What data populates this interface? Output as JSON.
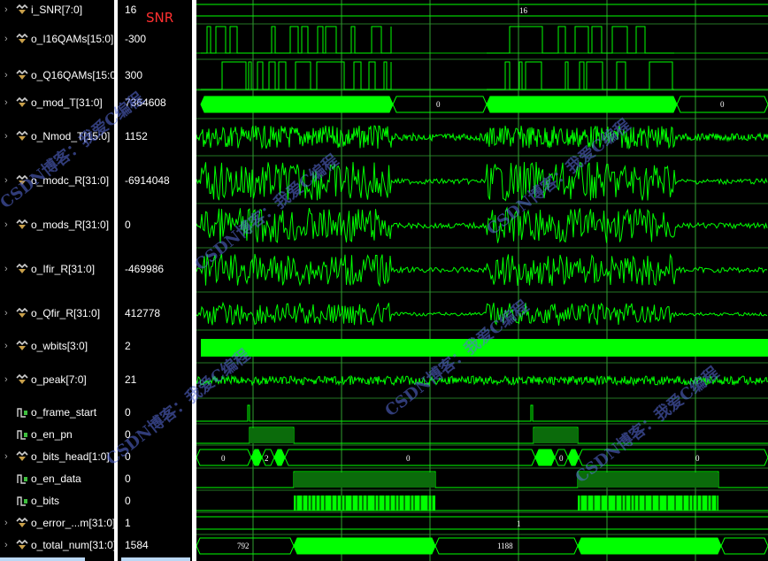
{
  "signals": [
    {
      "name": "i_SNR[7:0]",
      "value": "16",
      "kind": "bus"
    },
    {
      "name": "o_I16QAMs[15:0]",
      "value": "-300",
      "kind": "bus"
    },
    {
      "name": "o_Q16QAMs[15:0]",
      "value": "300",
      "kind": "bus"
    },
    {
      "name": "o_mod_T[31:0]",
      "value": "7364608",
      "kind": "bus"
    },
    {
      "name": "o_Nmod_T[15:0]",
      "value": "1152",
      "kind": "bus"
    },
    {
      "name": "o_modc_R[31:0]",
      "value": "-6914048",
      "kind": "bus"
    },
    {
      "name": "o_mods_R[31:0]",
      "value": "0",
      "kind": "bus"
    },
    {
      "name": "o_Ifir_R[31:0]",
      "value": "-469986",
      "kind": "bus"
    },
    {
      "name": "o_Qfir_R[31:0]",
      "value": "412778",
      "kind": "bus"
    },
    {
      "name": "o_wbits[3:0]",
      "value": "2",
      "kind": "bus"
    },
    {
      "name": "o_peak[7:0]",
      "value": "21",
      "kind": "bus"
    },
    {
      "name": "o_frame_start",
      "value": "0",
      "kind": "bit"
    },
    {
      "name": "o_en_pn",
      "value": "0",
      "kind": "bit"
    },
    {
      "name": "o_bits_head[1:0]",
      "value": "0",
      "kind": "bus"
    },
    {
      "name": "o_en_data",
      "value": "0",
      "kind": "bit"
    },
    {
      "name": "o_bits",
      "value": "0",
      "kind": "bit"
    },
    {
      "name": "o_error_...m[31:0]",
      "value": "1",
      "kind": "bus"
    },
    {
      "name": "o_total_num[31:0]",
      "value": "1584",
      "kind": "bus"
    }
  ],
  "annotation": "SNR",
  "wave_labels": {
    "snr": "16",
    "mod_t": "0",
    "bits_head_a": "0",
    "bits_head_b": "2",
    "bits_head_c": "0",
    "bits_head_d": "0",
    "bits_head_e": "0",
    "error_num": "1",
    "total_a": "792",
    "total_b": "1188"
  },
  "watermark": "CSDN博客：我爱C编程",
  "colors": {
    "wave": "#00ff00",
    "grid": "#2f9e2f",
    "bg": "#000000",
    "separator": "#ffffff"
  }
}
